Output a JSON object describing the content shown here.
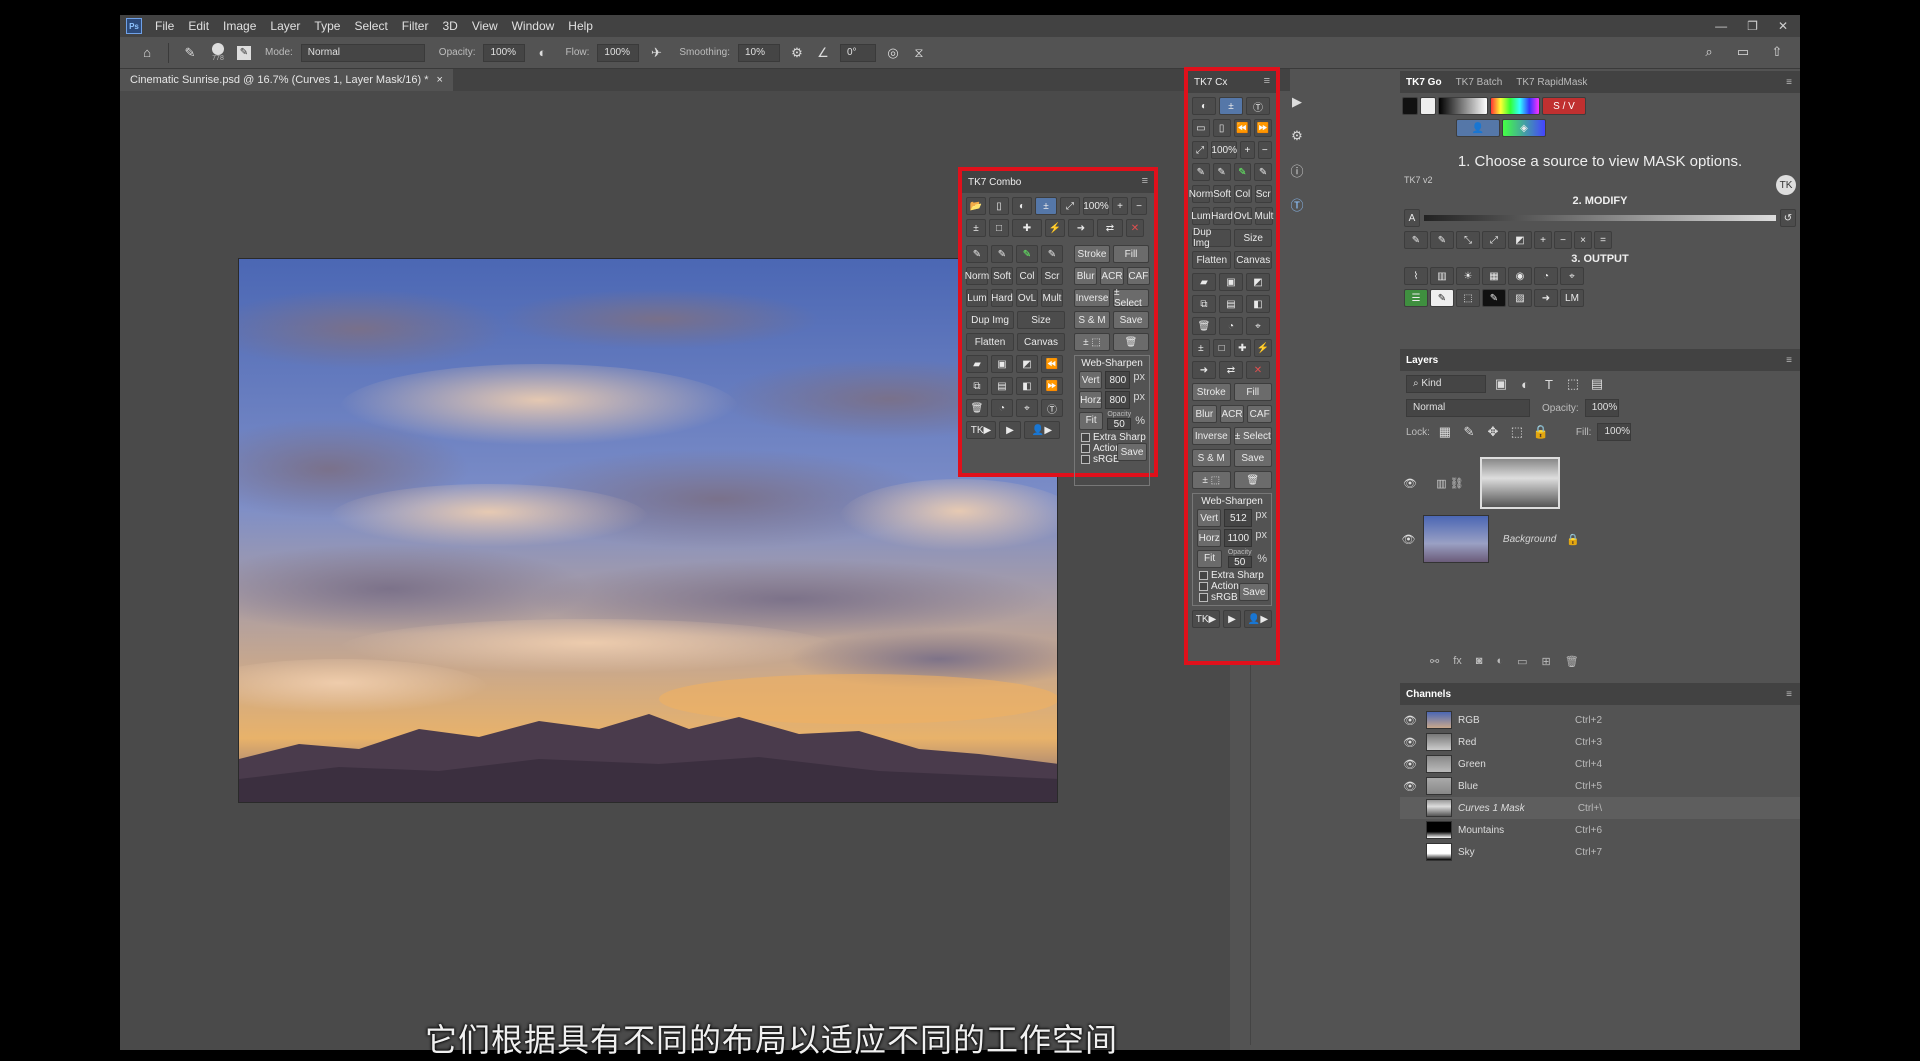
{
  "menubar": {
    "logo": "Ps",
    "items": [
      "File",
      "Edit",
      "Image",
      "Layer",
      "Type",
      "Select",
      "Filter",
      "3D",
      "View",
      "Window",
      "Help"
    ]
  },
  "options": {
    "brush_size": "778",
    "mode_label": "Mode:",
    "mode_value": "Normal",
    "opacity_label": "Opacity:",
    "opacity_value": "100%",
    "flow_label": "Flow:",
    "flow_value": "100%",
    "smoothing_label": "Smoothing:",
    "smoothing_value": "10%",
    "angle_value": "0°"
  },
  "document": {
    "tab_title": "Cinematic Sunrise.psd @ 16.7% (Curves 1, Layer Mask/16) *",
    "close": "×"
  },
  "tk7_combo": {
    "title": "TK7 Combo",
    "zoom": "100%",
    "stroke": "Stroke",
    "fill": "Fill",
    "blur": "Blur",
    "acr": "ACR",
    "caf": "CAF",
    "blend": [
      "Norm",
      "Soft",
      "Col",
      "Scr"
    ],
    "blend2": [
      "Lum",
      "Hard",
      "OvL",
      "Mult"
    ],
    "inverse": "Inverse",
    "pm_select": "± Select",
    "dup_img": "Dup Img",
    "size": "Size",
    "sm": "S & M",
    "save": "Save",
    "flatten": "Flatten",
    "canvas": "Canvas",
    "web_sharpen": "Web-Sharpen",
    "vert": "Vert",
    "vert_val": "800",
    "horz": "Horz",
    "horz_val": "800",
    "px": "px",
    "fit": "Fit",
    "opacity_label": "Opacity",
    "opacity_val": "50",
    "pct": "%",
    "extra_sharp": "Extra Sharp",
    "action": "Action",
    "srgb": "sRGB",
    "tk": "TK"
  },
  "tk7_cx": {
    "title": "TK7 Cx",
    "zoom": "100%",
    "blend": [
      "Norm",
      "Soft",
      "Col",
      "Scr"
    ],
    "blend2": [
      "Lum",
      "Hard",
      "OvL",
      "Mult"
    ],
    "dup_img": "Dup Img",
    "size": "Size",
    "flatten": "Flatten",
    "canvas": "Canvas",
    "stroke": "Stroke",
    "fill": "Fill",
    "blur": "Blur",
    "acr": "ACR",
    "caf": "CAF",
    "inverse": "Inverse",
    "pm_select": "± Select",
    "sm": "S & M",
    "save": "Save",
    "web_sharpen": "Web-Sharpen",
    "vert": "Vert",
    "vert_val": "512",
    "horz": "Horz",
    "horz_val": "1100",
    "px": "px",
    "fit": "Fit",
    "opacity_label": "Opacity",
    "opacity_val": "50",
    "pct": "%",
    "extra_sharp": "Extra Sharp",
    "action": "Action",
    "srgb": "sRGB",
    "tk": "TK"
  },
  "tk7_go": {
    "tabs": [
      "TK7 Go",
      "TK7 Batch",
      "TK7 RapidMask"
    ],
    "sv": "S / V",
    "instruction": "1. Choose a source to view MASK options.",
    "version": "TK7 v2",
    "modify": "2. MODIFY",
    "a": "A",
    "output": "3. OUTPUT",
    "lm": "LM"
  },
  "layers": {
    "title": "Layers",
    "kind": "Kind",
    "blend": "Normal",
    "opacity_label": "Opacity:",
    "opacity_value": "100%",
    "lock_label": "Lock:",
    "fill_label": "Fill:",
    "fill_value": "100%",
    "background": "Background"
  },
  "channels": {
    "title": "Channels",
    "rows": [
      {
        "name": "RGB",
        "shortcut": "Ctrl+2"
      },
      {
        "name": "Red",
        "shortcut": "Ctrl+3"
      },
      {
        "name": "Green",
        "shortcut": "Ctrl+4"
      },
      {
        "name": "Blue",
        "shortcut": "Ctrl+5"
      },
      {
        "name": "Curves 1 Mask",
        "shortcut": "Ctrl+\\"
      },
      {
        "name": "Mountains",
        "shortcut": "Ctrl+6"
      },
      {
        "name": "Sky",
        "shortcut": "Ctrl+7"
      }
    ]
  },
  "subtitle": "它们根据具有不同的布局以适应不同的工作空间"
}
